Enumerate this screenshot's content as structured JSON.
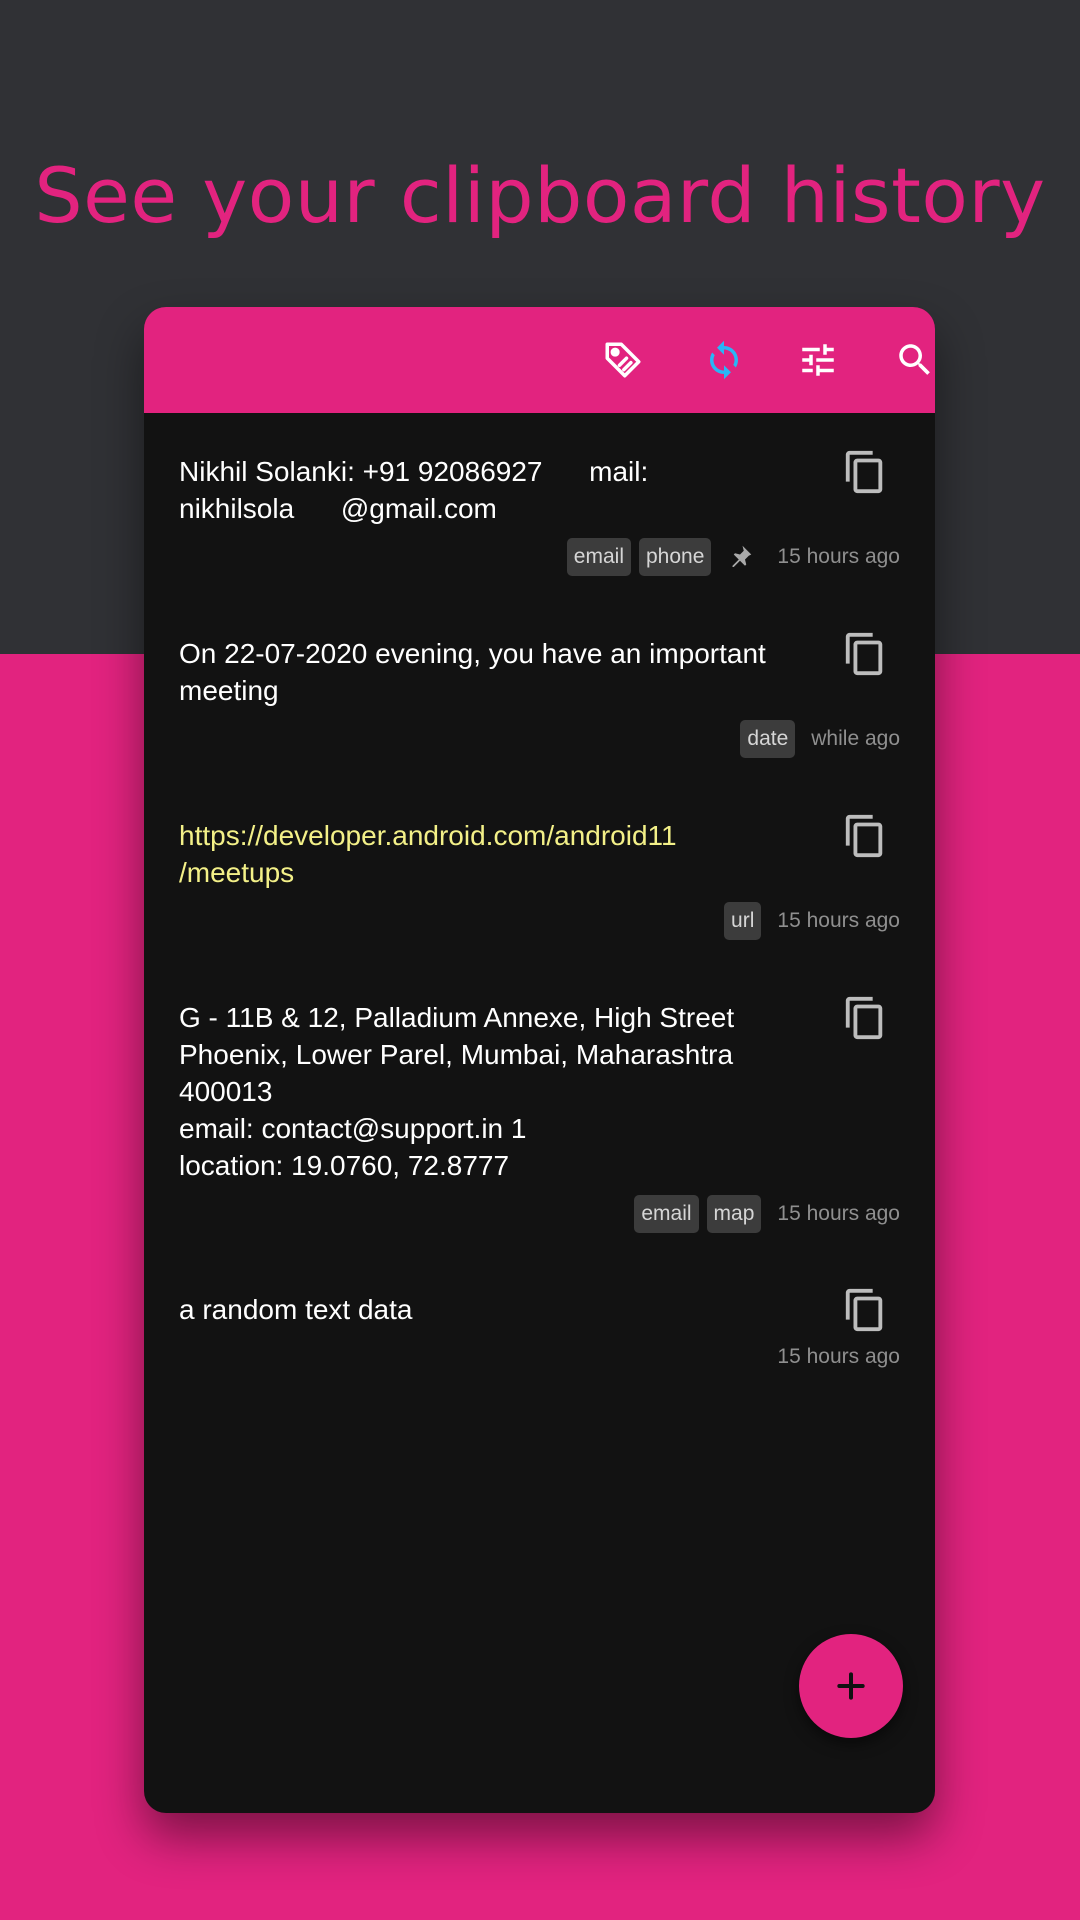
{
  "headline": "See your clipboard history",
  "colors": {
    "accent": "#e2237f",
    "top_background": "#303135",
    "card_background": "#121212",
    "sync_icon": "#29b6f6",
    "url_text": "#f3f088"
  },
  "appbar": {
    "actions": [
      {
        "icon": "tag-icon"
      },
      {
        "icon": "sync-icon"
      },
      {
        "icon": "filter-sliders-icon"
      },
      {
        "icon": "search-icon"
      }
    ]
  },
  "clips": [
    {
      "text": "Nikhil Solanki: +91 92086927      mail:\nnikhilsola      @gmail.com",
      "tags": [
        "email",
        "phone"
      ],
      "pinned": true,
      "time": "15 hours ago"
    },
    {
      "text": "On 22-07-2020 evening, you have an important\nmeeting",
      "tags": [
        "date"
      ],
      "pinned": false,
      "time": "while ago"
    },
    {
      "text": "https://developer.android.com/android11\n/meetups",
      "tags": [
        "url"
      ],
      "pinned": false,
      "time": "15 hours ago"
    },
    {
      "text": "G - 11B & 12, Palladium Annexe, High Street\nPhoenix, Lower Parel, Mumbai, Maharashtra\n400013\nemail: contact@support.in 1\nlocation: 19.0760, 72.8777",
      "tags": [
        "email",
        "map"
      ],
      "pinned": false,
      "time": "15 hours ago"
    },
    {
      "text": "a random text data",
      "tags": [],
      "pinned": false,
      "time": "15 hours ago"
    }
  ],
  "fab": {
    "icon": "plus-icon"
  }
}
